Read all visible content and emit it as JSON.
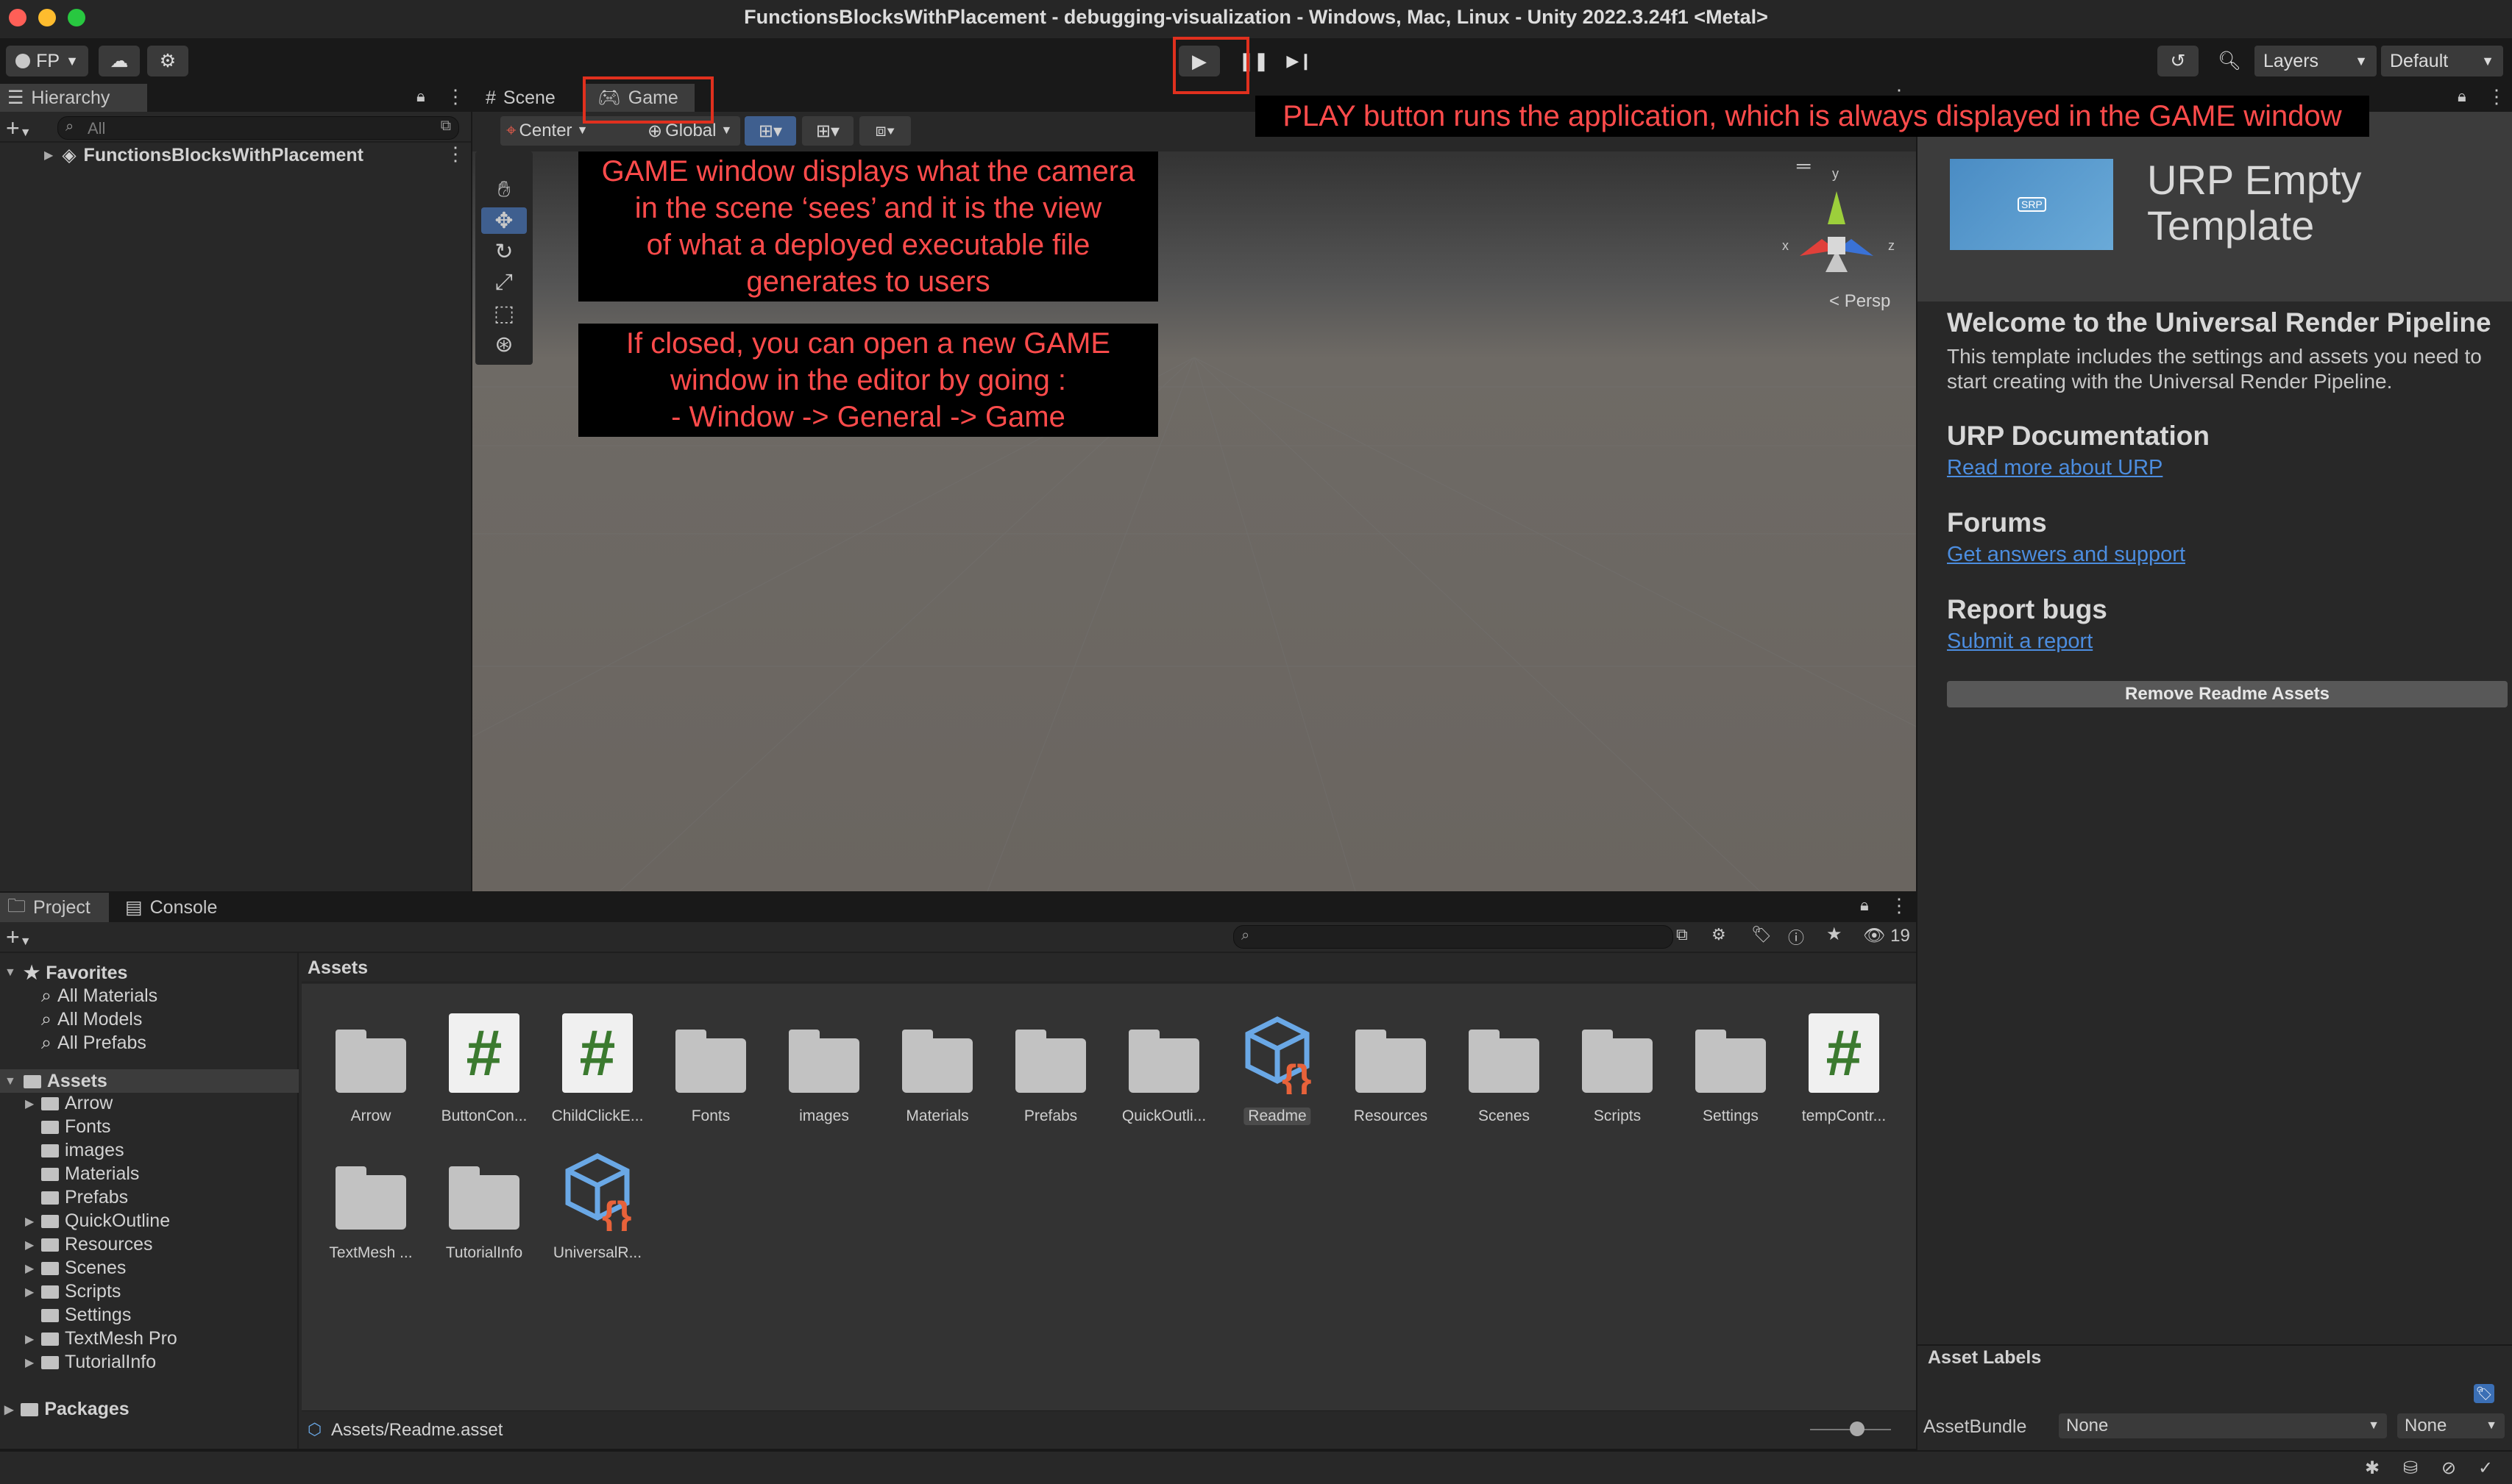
{
  "window": {
    "title": "FunctionsBlocksWithPlacement - debugging-visualization - Windows, Mac, Linux - Unity 2022.3.24f1 <Metal>"
  },
  "toolbar": {
    "account_label": "FP",
    "layers_label": "Layers",
    "layout_label": "Default"
  },
  "hierarchy": {
    "tab_label": "Hierarchy",
    "search_placeholder": "All",
    "root_item": "FunctionsBlocksWithPlacement"
  },
  "scene_view": {
    "tabs": [
      "Scene",
      "Game"
    ],
    "active_tab": "Game",
    "pivot_label": "Center",
    "space_label": "Global",
    "gizmo_persp": "Persp",
    "gizmo_axes": [
      "y",
      "x",
      "z"
    ]
  },
  "annotations": {
    "play_note": "PLAY button runs the application, which is always displayed in the GAME window",
    "game_note_lines": [
      "GAME window displays what the camera",
      "in the scene ‘sees’ and it is the view",
      "of what a deployed executable file",
      "generates to users"
    ],
    "open_note_lines": [
      "If closed, you can open a new GAME",
      "window in the editor by going :",
      "- Window -> General -> Game"
    ]
  },
  "inspector": {
    "template_title_line1": "URP Empty",
    "template_title_line2": "Template",
    "thumb_badge": "SRP",
    "welcome_heading": "Welcome to the Universal Render Pipeline",
    "welcome_body": "This template includes the settings and assets you need to start creating with the Universal Render Pipeline.",
    "doc_heading": "URP Documentation",
    "doc_link": "Read more about URP",
    "forums_heading": "Forums",
    "forums_link": "Get answers and support",
    "bugs_heading": "Report bugs",
    "bugs_link": "Submit a report",
    "remove_button": "Remove Readme Assets",
    "asset_labels_heading": "Asset Labels",
    "assetbundle_label": "AssetBundle",
    "assetbundle_value": "None",
    "variant_value": "None"
  },
  "project": {
    "tabs": [
      "Project",
      "Console"
    ],
    "hidden_count": "19",
    "breadcrumb": "Assets",
    "favorites_label": "Favorites",
    "favorites": [
      "All Materials",
      "All Models",
      "All Prefabs"
    ],
    "assets_label": "Assets",
    "asset_folders": [
      {
        "name": "Arrow",
        "expandable": true
      },
      {
        "name": "Fonts",
        "expandable": false
      },
      {
        "name": "images",
        "expandable": false
      },
      {
        "name": "Materials",
        "expandable": false
      },
      {
        "name": "Prefabs",
        "expandable": false
      },
      {
        "name": "QuickOutline",
        "expandable": true
      },
      {
        "name": "Resources",
        "expandable": true
      },
      {
        "name": "Scenes",
        "expandable": true
      },
      {
        "name": "Scripts",
        "expandable": true
      },
      {
        "name": "Settings",
        "expandable": false
      },
      {
        "name": "TextMesh Pro",
        "expandable": true
      },
      {
        "name": "TutorialInfo",
        "expandable": true
      }
    ],
    "packages_label": "Packages",
    "grid_row1": [
      {
        "label": "Arrow",
        "kind": "folder"
      },
      {
        "label": "ButtonCon...",
        "kind": "script"
      },
      {
        "label": "ChildClickE...",
        "kind": "script"
      },
      {
        "label": "Fonts",
        "kind": "folder"
      },
      {
        "label": "images",
        "kind": "folder"
      },
      {
        "label": "Materials",
        "kind": "folder"
      },
      {
        "label": "Prefabs",
        "kind": "folder"
      },
      {
        "label": "QuickOutli...",
        "kind": "folder"
      },
      {
        "label": "Readme",
        "kind": "readme",
        "selected": true
      },
      {
        "label": "Resources",
        "kind": "folder"
      },
      {
        "label": "Scenes",
        "kind": "folder"
      },
      {
        "label": "Scripts",
        "kind": "folder"
      },
      {
        "label": "Settings",
        "kind": "folder"
      },
      {
        "label": "tempContr...",
        "kind": "script"
      }
    ],
    "grid_row2": [
      {
        "label": "TextMesh ...",
        "kind": "folder"
      },
      {
        "label": "TutorialInfo",
        "kind": "folder"
      },
      {
        "label": "UniversalR...",
        "kind": "readme"
      }
    ],
    "script_glyph": "#",
    "status_path": "Assets/Readme.asset"
  }
}
